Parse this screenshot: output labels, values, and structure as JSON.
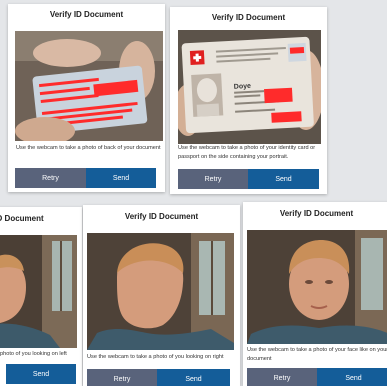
{
  "colors": {
    "retry_button": "#59637b",
    "send_button": "#145d99",
    "redaction": "#ff2b2b"
  },
  "cards": [
    {
      "title": "Verify ID Document",
      "photo": "back of ID card held in hand",
      "instruction": "Use the webcam to take a photo of back of your document",
      "retry_label": "Retry",
      "send_label": "Send"
    },
    {
      "title": "Verify ID Document",
      "photo": "front of Swiss identity card",
      "id_card_name": "Doye",
      "instruction": "Use the webcam to take a photo of your identity card or passport on the side containing your portrait.",
      "retry_label": "Retry",
      "send_label": "Send"
    },
    {
      "title": "Verify ID Document",
      "photo": "face looking left",
      "instruction": "photo of you looking on left",
      "send_label": "Send"
    },
    {
      "title": "Verify ID Document",
      "photo": "face looking right",
      "instruction": "Use the webcam to take a photo of you looking on right",
      "retry_label": "Retry",
      "send_label": "Send"
    },
    {
      "title": "Verify ID Document",
      "photo": "face looking straight",
      "instruction": "Use the webcam to take a photo of your face like on your document",
      "retry_label": "Retry",
      "send_label": "Send"
    }
  ]
}
